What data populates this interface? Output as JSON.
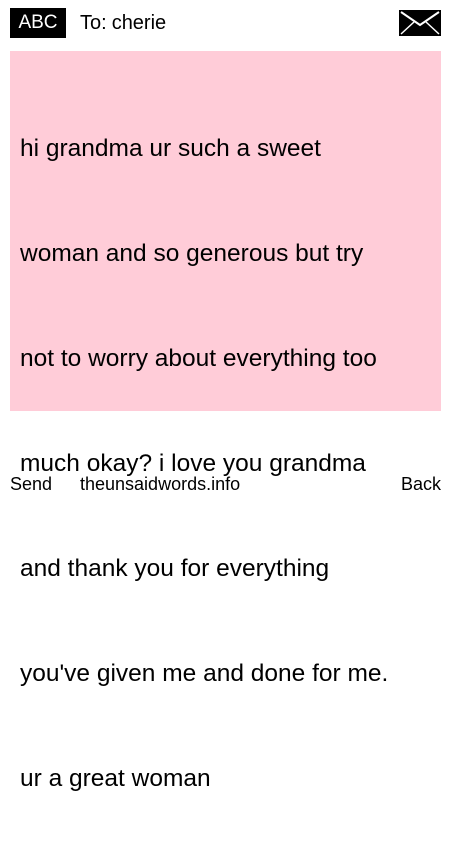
{
  "header": {
    "mode_badge": "ABC",
    "to_prefix": "To:",
    "recipient": "cherie",
    "envelope_icon": "envelope-icon"
  },
  "message": {
    "lines": [
      "hi grandma ur such a sweet",
      "woman and so generous but try",
      "not to worry about everything too",
      "much okay? i love you grandma",
      "and thank you for everything",
      "you've given me and done for me.",
      "ur a great woman"
    ],
    "background_color": "#ffccd8"
  },
  "footer": {
    "send_label": "Send",
    "site_label": "theunsaidwords.info",
    "back_label": "Back"
  }
}
